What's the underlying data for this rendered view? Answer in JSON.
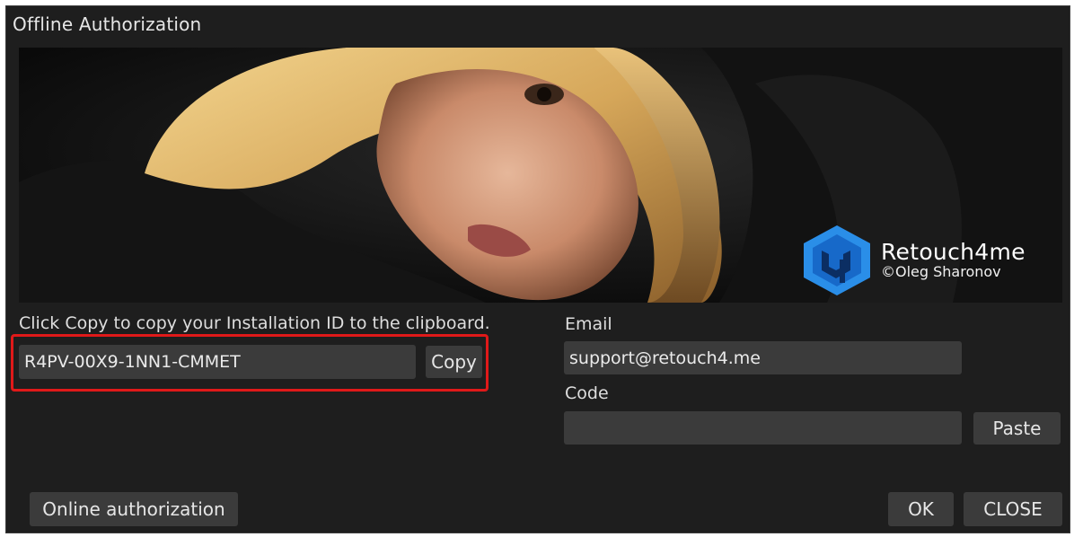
{
  "window": {
    "title": "Offline Authorization"
  },
  "banner": {
    "logo": {
      "brand": "Retouch4me",
      "copyright": "©Oleg Sharonov",
      "color": "#2a8ee8"
    }
  },
  "installation": {
    "hint": "Click Copy to copy your Installation ID to the clipboard.",
    "id_value": "R4PV-00X9-1NN1-CMMET",
    "copy_label": "Copy",
    "highlight_color": "#e01919"
  },
  "form": {
    "email_label": "Email",
    "email_value": "support@retouch4.me",
    "code_label": "Code",
    "code_value": "",
    "paste_label": "Paste"
  },
  "footer": {
    "online_label": "Online authorization",
    "ok_label": "OK",
    "close_label": "CLOSE"
  }
}
